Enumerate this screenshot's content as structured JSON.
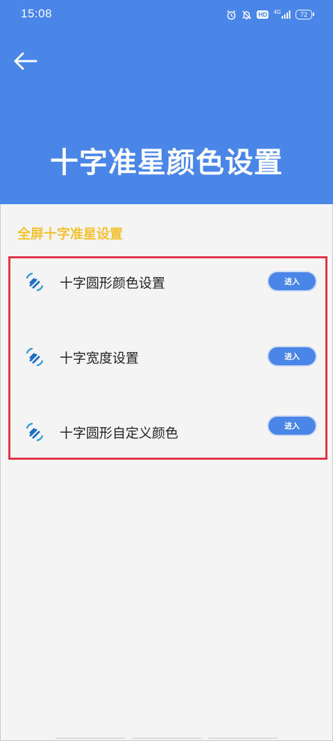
{
  "status_bar": {
    "time": "15:08",
    "hd": "HD",
    "network": "4G",
    "battery": "72"
  },
  "header": {
    "title": "十字准星颜色设置"
  },
  "section": {
    "title": "全屏十字准星设置"
  },
  "items": [
    {
      "label": "十字圆形颜色设置",
      "button": "进入"
    },
    {
      "label": "十字宽度设置",
      "button": "进入"
    },
    {
      "label": "十字圆形自定义颜色",
      "button": "进入"
    }
  ],
  "colors": {
    "header_bg": "#4a86e8",
    "section_title": "#f2c230",
    "highlight_border": "#dd3344",
    "button_bg": "#4a86e8"
  }
}
